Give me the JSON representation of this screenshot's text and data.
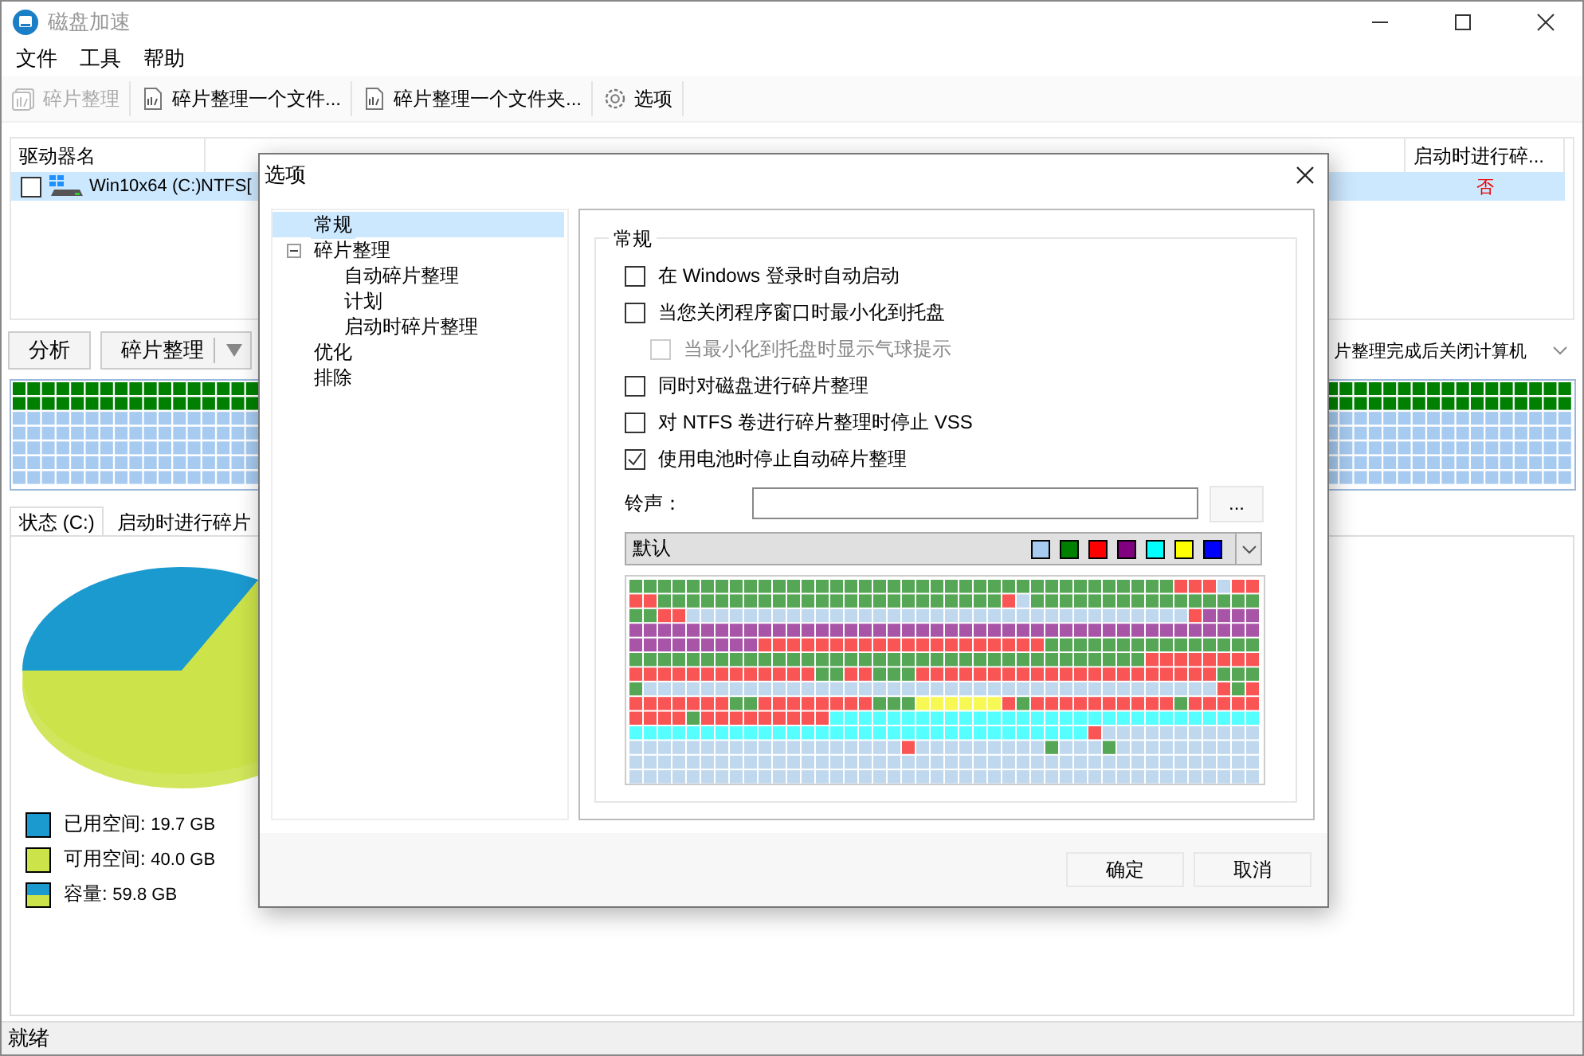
{
  "window": {
    "title": "磁盘加速"
  },
  "menu": [
    "文件",
    "工具",
    "帮助"
  ],
  "toolbar": [
    {
      "label": "碎片整理",
      "disabled": true
    },
    {
      "label": "碎片整理一个文件...",
      "disabled": false
    },
    {
      "label": "碎片整理一个文件夹...",
      "disabled": false
    },
    {
      "label": "选项",
      "disabled": false
    }
  ],
  "drive_table": {
    "columns": [
      "驱动器名",
      "启动时进行碎..."
    ],
    "rows": [
      {
        "name": "Win10x64 (C:)",
        "file_system": "NTFS[",
        "boot_defrag": "否",
        "checked": false,
        "selected": true
      }
    ]
  },
  "actions": {
    "analyze": "分析",
    "defrag": "碎片整理",
    "after_action": "片整理完成后关闭计算机"
  },
  "tabs": [
    {
      "label": "状态 (C:)",
      "selected": true
    },
    {
      "label": "启动时进行碎片",
      "selected": false
    }
  ],
  "status_panel": {
    "legend": [
      {
        "label": "已用空间:",
        "value": "19.7 GB",
        "kind": "used"
      },
      {
        "label": "可用空间:",
        "value": "40.0 GB",
        "kind": "free"
      },
      {
        "label": "容量:",
        "value": "59.8 GB",
        "kind": "total"
      }
    ]
  },
  "status_bar": "就绪",
  "dialog": {
    "title": "选项",
    "tree": [
      {
        "label": "常规",
        "selected": true
      },
      {
        "label": "碎片整理",
        "selected": false,
        "expanded": true,
        "children": [
          {
            "label": "自动碎片整理",
            "selected": false
          },
          {
            "label": "计划",
            "selected": false
          },
          {
            "label": "启动时碎片整理",
            "selected": false
          }
        ]
      },
      {
        "label": "优化",
        "selected": false
      },
      {
        "label": "排除",
        "selected": false
      }
    ],
    "group_title": "常规",
    "options": [
      {
        "label": "在 Windows 登录时自动启动",
        "checked": false,
        "disabled": false
      },
      {
        "label": "当您关闭程序窗口时最小化到托盘",
        "checked": false,
        "disabled": false,
        "children": [
          {
            "label": "当最小化到托盘时显示气球提示",
            "checked": false,
            "disabled": true
          }
        ]
      },
      {
        "label": "同时对磁盘进行碎片整理",
        "checked": false,
        "disabled": false
      },
      {
        "label": "对 NTFS 卷进行碎片整理时停止 VSS",
        "checked": false,
        "disabled": false
      },
      {
        "label": "使用电池时停止自动碎片整理",
        "checked": true,
        "disabled": false
      }
    ],
    "sound_label": "铃声：",
    "browse_button": "...",
    "scheme": {
      "value": "默认",
      "swatches": [
        {
          "color": "#a6caf0"
        },
        {
          "color": "#008000"
        },
        {
          "color": "#ff0000"
        },
        {
          "color": "#800080"
        },
        {
          "color": "#00ffff"
        },
        {
          "color": "#ffff00"
        },
        {
          "color": "#0000ff"
        }
      ]
    },
    "buttons": [
      "确定",
      "取消"
    ]
  }
}
